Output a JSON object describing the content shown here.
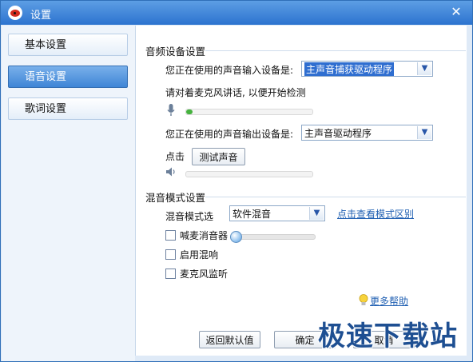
{
  "window": {
    "title": "设置"
  },
  "sidebar": {
    "items": [
      {
        "label": "基本设置"
      },
      {
        "label": "语音设置"
      },
      {
        "label": "歌词设置"
      }
    ]
  },
  "audio": {
    "section_title": "音频设备设置",
    "input_label": "您正在使用的声音输入设备是:",
    "input_value": "主声音捕获驱动程序",
    "mic_hint": "请对着麦克风讲话, 以便开始检测",
    "mic_level": 0.05,
    "output_label": "您正在使用的声音输出设备是:",
    "output_value": "主声音驱动程序",
    "click_label": "点击",
    "test_button": "测试声音",
    "output_level": 0
  },
  "mix": {
    "section_title": "混音模式设置",
    "mode_label": "混音模式选",
    "mode_value": "软件混音",
    "mode_link": "点击查看模式区别",
    "options": [
      {
        "label": "喊麦消音器",
        "checked": false
      },
      {
        "label": "启用混响",
        "checked": false
      },
      {
        "label": "麦克风监听",
        "checked": false
      }
    ],
    "muffler_level": 0
  },
  "help": {
    "label": "更多帮助"
  },
  "footer": {
    "reset_button": "返回默认值",
    "ok_button": "确定",
    "cancel_button": "取消"
  },
  "watermark": "极速下载站"
}
